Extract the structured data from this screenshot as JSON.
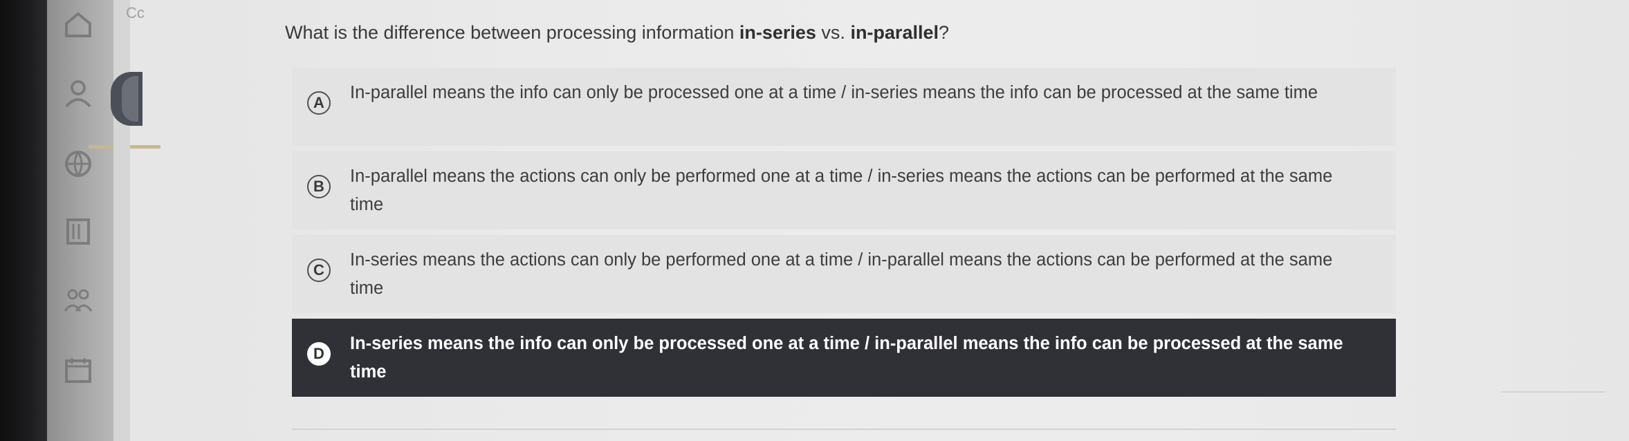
{
  "corner_text": "Cc",
  "question": {
    "prefix": "What is the difference between processing information ",
    "bold1": "in-series",
    "middle": " vs. ",
    "bold2": "in-parallel",
    "suffix": "?"
  },
  "options": [
    {
      "letter": "A",
      "text": "In-parallel means the info can only be processed one at a time / in-series means the info can be processed at the same time",
      "selected": false
    },
    {
      "letter": "B",
      "text": "In-parallel means the actions can only be performed one at a time / in-series means the actions can be performed at the same time",
      "selected": false
    },
    {
      "letter": "C",
      "text": "In-series means the actions can only be performed one at a time / in-parallel means the actions can be performed at the same time",
      "selected": false
    },
    {
      "letter": "D",
      "text": "In-series means the info can only be processed one at a time / in-parallel means the info can be processed at the same time",
      "selected": true
    }
  ],
  "colors": {
    "selected_background": "#2f3136",
    "option_background": "#e3e3e3"
  },
  "sidebar_icons": [
    "home-icon",
    "user-icon",
    "globe-icon",
    "book-icon",
    "people-icon",
    "calendar-icon"
  ]
}
